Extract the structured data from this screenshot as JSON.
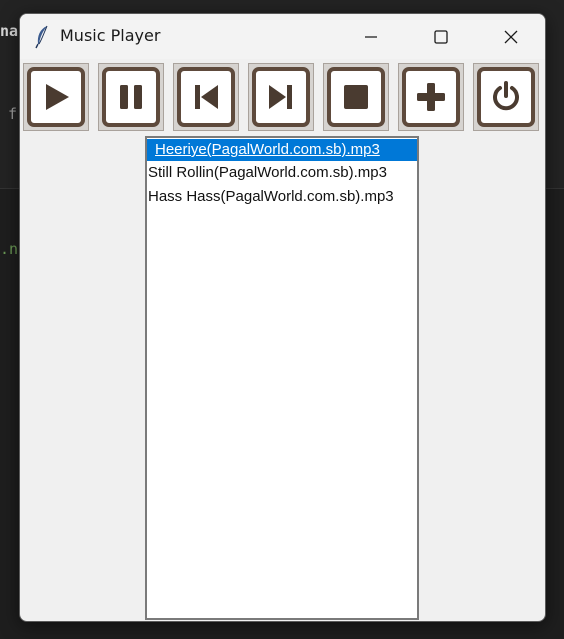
{
  "background": {
    "fragment_1": "na",
    "fragment_2": "f",
    "fragment_3": ".ns"
  },
  "window": {
    "title": "Music Player",
    "app_icon": "feather-icon",
    "controls": {
      "minimize": "minimize-icon",
      "maximize": "maximize-icon",
      "close": "close-icon"
    }
  },
  "toolbar": {
    "buttons": [
      {
        "icon": "play-icon"
      },
      {
        "icon": "pause-icon"
      },
      {
        "icon": "previous-icon"
      },
      {
        "icon": "next-icon"
      },
      {
        "icon": "stop-icon"
      },
      {
        "icon": "add-icon"
      },
      {
        "icon": "power-icon"
      }
    ],
    "icon_color": "#4a3b30",
    "frame_color": "#5e4a3c"
  },
  "playlist": {
    "items": [
      "Heeriye(PagalWorld.com.sb).mp3",
      "Still Rollin(PagalWorld.com.sb).mp3",
      "Hass Hass(PagalWorld.com.sb).mp3"
    ],
    "selected_index": 0,
    "selected_color": "#0078d7"
  }
}
